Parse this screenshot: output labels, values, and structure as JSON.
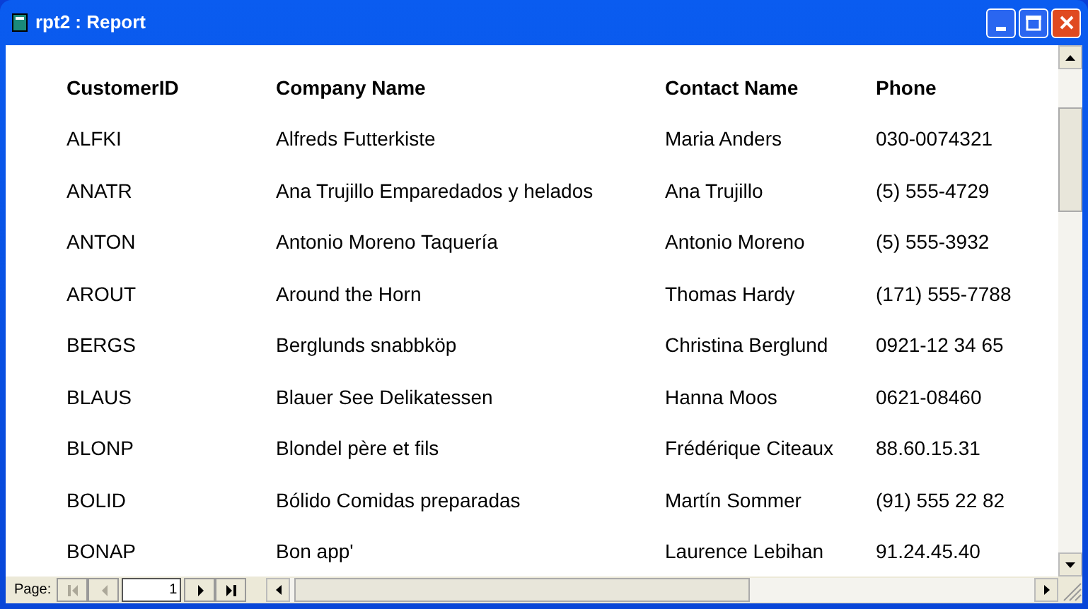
{
  "window": {
    "title": "rpt2 : Report"
  },
  "table": {
    "columns": [
      "CustomerID",
      "Company Name",
      "Contact Name",
      "Phone"
    ],
    "rows": [
      [
        "ALFKI",
        "Alfreds Futterkiste",
        "Maria Anders",
        "030-0074321"
      ],
      [
        "ANATR",
        "Ana Trujillo Emparedados y helados",
        "Ana Trujillo",
        "(5) 555-4729"
      ],
      [
        "ANTON",
        "Antonio Moreno Taquería",
        "Antonio Moreno",
        "(5) 555-3932"
      ],
      [
        "AROUT",
        "Around the Horn",
        "Thomas Hardy",
        "(171) 555-7788"
      ],
      [
        "BERGS",
        "Berglunds snabbköp",
        "Christina Berglund",
        "0921-12 34 65"
      ],
      [
        "BLAUS",
        "Blauer See Delikatessen",
        "Hanna Moos",
        "0621-08460"
      ],
      [
        "BLONP",
        "Blondel père et fils",
        "Frédérique Citeaux",
        "88.60.15.31"
      ],
      [
        "BOLID",
        "Bólido Comidas preparadas",
        "Martín Sommer",
        "(91) 555 22 82"
      ],
      [
        "BONAP",
        "Bon app'",
        "Laurence Lebihan",
        "91.24.45.40"
      ]
    ]
  },
  "navigation": {
    "label": "Page:",
    "page": "1",
    "buttons": [
      {
        "kind": "first",
        "disabled": true
      },
      {
        "kind": "prev",
        "disabled": true
      },
      {
        "kind": "next",
        "disabled": false
      },
      {
        "kind": "last",
        "disabled": false
      }
    ]
  }
}
